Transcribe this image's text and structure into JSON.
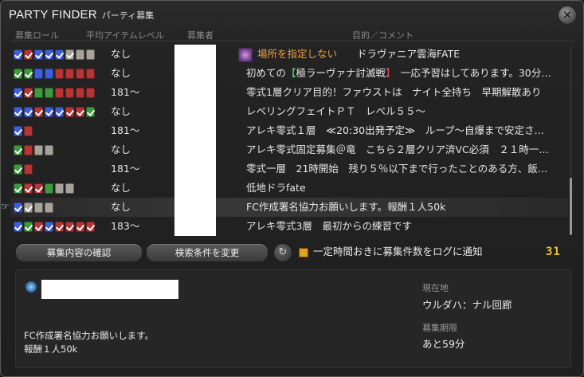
{
  "window": {
    "title_en": "PARTY FINDER",
    "title_jp": "パーティ募集"
  },
  "headers": {
    "roles": "募集ロール",
    "avg_ilvl": "平均アイテムレベル",
    "leader": "募集者",
    "comment": "目的／コメント"
  },
  "rows": [
    {
      "roles": [
        "tank-filled",
        "dps-filled",
        "tank-filled",
        "tank-filled",
        "tank-filled",
        "empty-filled",
        "empty",
        "empty"
      ],
      "ilvl": "なし",
      "location_icon": true,
      "location": "場所を指定しない",
      "comment_rest": "　　ドラヴァニア雲海FATE"
    },
    {
      "roles": [
        "healer-filled",
        "healer-filled",
        "tank",
        "tank",
        "dps",
        "dps",
        "dps",
        "dps"
      ],
      "ilvl": "なし",
      "comment_pre": "初めての",
      "comment_hl_open": "【",
      "comment_hl_text": "極ラーヴァナ討滅戦",
      "comment_hl_close": "】",
      "comment_post": "　一応予習はしてあります。30分…"
    },
    {
      "roles": [
        "tank-filled",
        "dps-filled",
        "healer",
        "healer",
        "dps",
        "dps",
        "dps",
        "dps"
      ],
      "ilvl": "181～",
      "comment": "零式1層クリア目的！ファウストは　ナイト全持ち　早期解散あり"
    },
    {
      "roles": [
        "tank-filled",
        "tank-filled",
        "dps-filled",
        "tank-filled",
        "tank-filled",
        "dps-filled",
        "dps-filled",
        "healer-filled"
      ],
      "ilvl": "なし",
      "comment": "レベリングフェイトＰＴ　レベル５５～"
    },
    {
      "roles": [
        "tank-filled",
        "dps"
      ],
      "ilvl": "181～",
      "comment": "アレキ零式１層　≪20:30出発予定≫　ループ～自爆まで安定さ…"
    },
    {
      "roles": [
        "healer-filled",
        "dps",
        "empty",
        "empty"
      ],
      "ilvl": "なし",
      "comment": "アレキ零式固定募集＠竜　こちら２層クリア済VC必須　２１時一…"
    },
    {
      "roles": [
        "healer-filled",
        "dps"
      ],
      "ilvl": "181～",
      "comment": "零式一層　21時開始　残り５％以下まで行ったことのある方、飯…"
    },
    {
      "roles": [
        "healer-filled",
        "dps-filled",
        "dps-filled",
        "healer",
        "empty",
        "empty"
      ],
      "ilvl": "なし",
      "comment": "低地ドラfate"
    },
    {
      "roles": [
        "tank-filled",
        "empty-filled",
        "empty",
        "empty"
      ],
      "ilvl": "なし",
      "comment": "FC作成署名協力お願いします。報酬１人50k",
      "selected": true
    },
    {
      "roles": [
        "tank-filled",
        "healer-filled",
        "dps-filled",
        "tank-filled",
        "dps-filled",
        "dps-filled",
        "dps-filled",
        "dps-filled"
      ],
      "ilvl": "183～",
      "comment": "アレキ零式3層　最初からの練習です"
    }
  ],
  "buttons": {
    "view_details": "募集内容の確認",
    "change_search": "検索条件を変更"
  },
  "notify_label": "一定時間おきに募集件数をログに通知",
  "count": "31",
  "detail": {
    "comment_line1": "FC作成署名協力お願いします。",
    "comment_line2": "報酬１人50k",
    "location_label": "現在地",
    "location_value": "ウルダハ：ナル回廊",
    "expiry_label": "募集期限",
    "expiry_value": "あと59分"
  },
  "colors": {
    "tank": "#3e5fd8",
    "healer": "#3f9a3f",
    "dps": "#b53636",
    "empty": "#a8a39a",
    "location_text": "#f0a040",
    "count": "#f0c030"
  },
  "icons": {
    "close": "close-icon",
    "refresh": "refresh-icon",
    "pointer": "hand-pointer-icon",
    "location": "location-marker-icon",
    "party": "party-icon"
  }
}
